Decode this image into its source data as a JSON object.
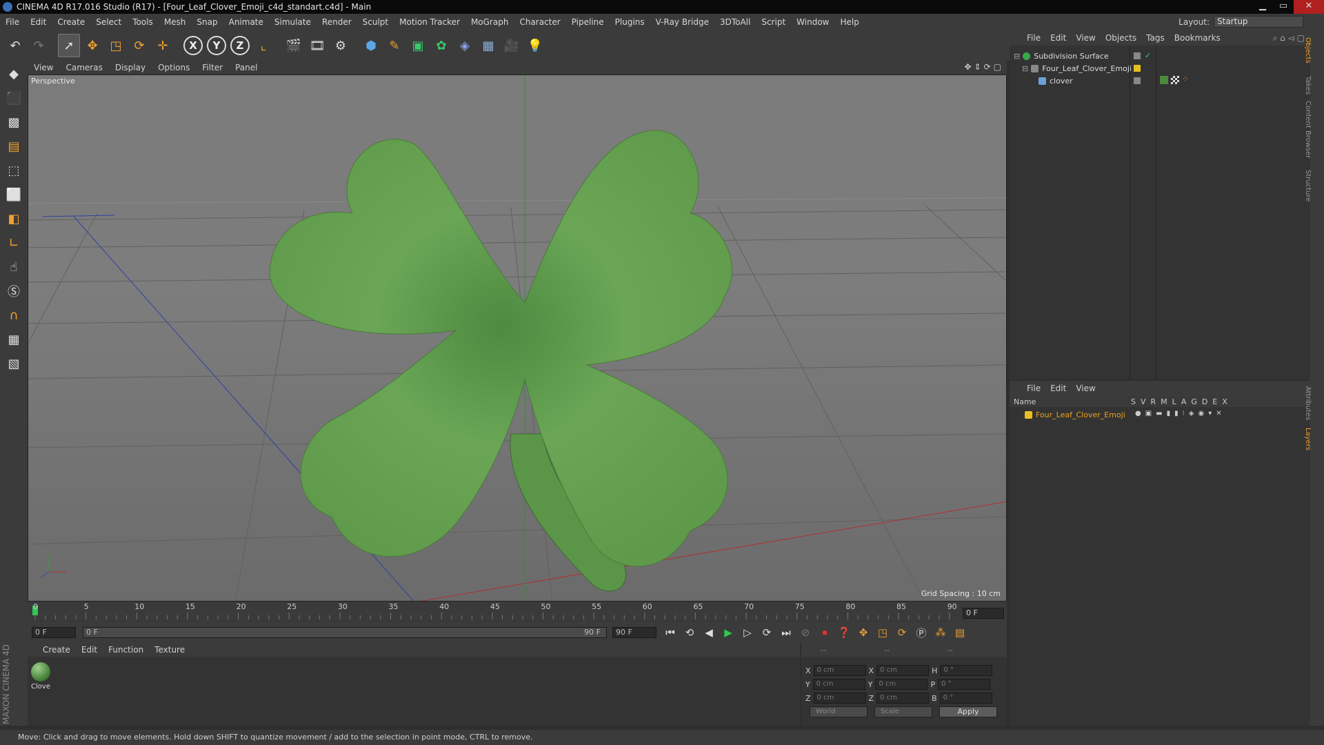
{
  "window": {
    "title": "CINEMA 4D R17.016 Studio (R17) - [Four_Leaf_Clover_Emoji_c4d_standart.c4d] - Main"
  },
  "menubar": {
    "items": [
      "File",
      "Edit",
      "Create",
      "Select",
      "Tools",
      "Mesh",
      "Snap",
      "Animate",
      "Simulate",
      "Render",
      "Sculpt",
      "Motion Tracker",
      "MoGraph",
      "Character",
      "Pipeline",
      "Plugins",
      "V-Ray Bridge",
      "3DToAll",
      "Script",
      "Window",
      "Help"
    ],
    "layout_label": "Layout:",
    "layout_value": "Startup"
  },
  "toolbar": {
    "icons": [
      "undo-icon",
      "redo-icon",
      "select-arrow-icon",
      "move-icon",
      "scale-icon",
      "rotate-icon",
      "move-last-icon",
      "x-axis-lock-icon",
      "y-axis-lock-icon",
      "z-axis-lock-icon",
      "world-coord-icon",
      "render-view-icon",
      "render-picture-icon",
      "edit-render-settings-icon",
      "cube-icon",
      "pen-spline-icon",
      "subdivision-icon",
      "array-icon",
      "deformer-icon",
      "floor-icon",
      "camera-icon",
      "light-icon"
    ],
    "axis_labels": [
      "X",
      "Y",
      "Z"
    ]
  },
  "viewport": {
    "menu": [
      "View",
      "Cameras",
      "Display",
      "Options",
      "Filter",
      "Panel"
    ],
    "label": "Perspective",
    "grid_spacing": "Grid Spacing : 10 cm"
  },
  "timeline": {
    "ticks": [
      "0",
      "5",
      "10",
      "15",
      "20",
      "25",
      "30",
      "35",
      "40",
      "45",
      "50",
      "55",
      "60",
      "65",
      "70",
      "75",
      "80",
      "85",
      "90"
    ],
    "current_frame": "0 F",
    "start_frame": "0 F",
    "range_start": "0 F",
    "range_end": "90 F",
    "end_frame": "90 F"
  },
  "material_manager": {
    "menu": [
      "Create",
      "Edit",
      "Function",
      "Texture"
    ],
    "materials": [
      {
        "name": "Clove"
      }
    ]
  },
  "coordinates": {
    "headers": [
      "--",
      "--",
      "--"
    ],
    "rows": [
      {
        "a": "X",
        "av": "0 cm",
        "b": "X",
        "bv": "0 cm",
        "c": "H",
        "cv": "0 °"
      },
      {
        "a": "Y",
        "av": "0 cm",
        "b": "Y",
        "bv": "0 cm",
        "c": "P",
        "cv": "0 °"
      },
      {
        "a": "Z",
        "av": "0 cm",
        "b": "Z",
        "bv": "0 cm",
        "c": "B",
        "cv": "0 °"
      }
    ],
    "mode": "World",
    "type": "Scale",
    "apply": "Apply"
  },
  "object_manager": {
    "menu": [
      "File",
      "Edit",
      "View",
      "Objects",
      "Tags",
      "Bookmarks"
    ],
    "objects": [
      {
        "name": "Subdivision Surface",
        "color": "#39a84a"
      },
      {
        "name": "Four_Leaf_Clover_Emoji",
        "color": "#aaaaaa"
      },
      {
        "name": "clover",
        "color": "#6ea0d8"
      }
    ]
  },
  "layer_manager": {
    "menu": [
      "File",
      "Edit",
      "View"
    ],
    "columns": [
      "Name",
      "S",
      "V",
      "R",
      "M",
      "L",
      "A",
      "G",
      "D",
      "E",
      "X"
    ],
    "layers": [
      {
        "name": "Four_Leaf_Clover_Emoji",
        "color": "#e8c020"
      }
    ]
  },
  "right_tabs": [
    "Objects",
    "Takes",
    "Content Browser",
    "Structure",
    "Attributes",
    "Layers"
  ],
  "status": "Move: Click and drag to move elements. Hold down SHIFT to quantize movement / add to the selection in point mode, CTRL to remove.",
  "brand": "MAXON CINEMA 4D"
}
